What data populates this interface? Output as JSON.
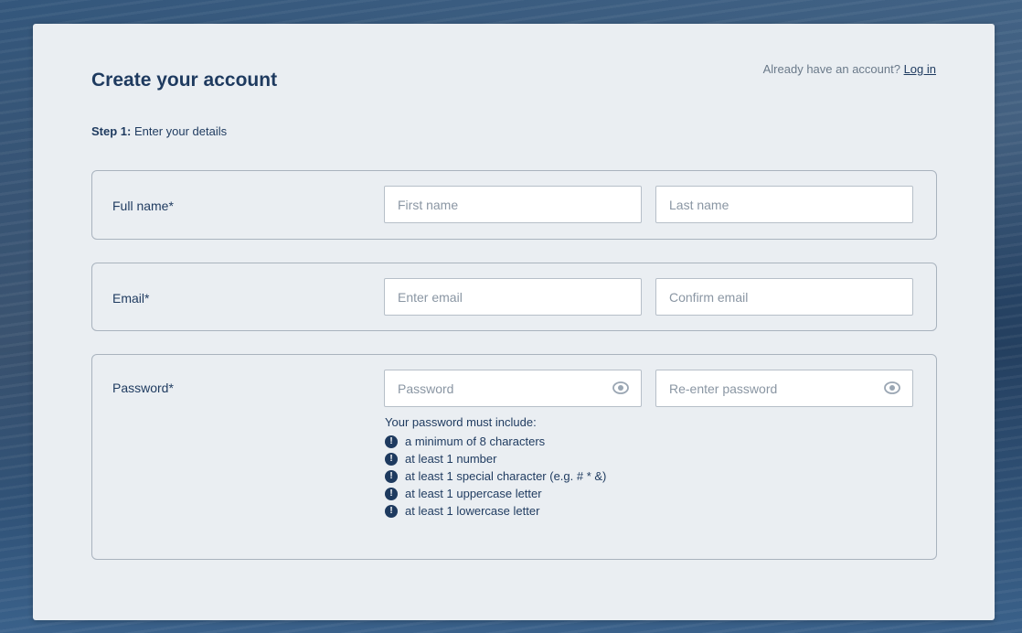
{
  "page": {
    "title": "Create your account",
    "login_prompt": "Already have an account?",
    "login_link": "Log in",
    "step_label": "Step 1:",
    "step_text": " Enter your details"
  },
  "full_name": {
    "label": "Full name*",
    "first_placeholder": "First name",
    "last_placeholder": "Last name"
  },
  "email": {
    "label": "Email*",
    "email_placeholder": "Enter email",
    "confirm_placeholder": "Confirm email"
  },
  "password": {
    "label": "Password*",
    "password_placeholder": "Password",
    "reenter_placeholder": "Re-enter password",
    "rules_heading": "Your password must include:",
    "rules": [
      "a minimum of 8 characters",
      "at least 1 number",
      "at least 1 special character (e.g. # * &)",
      "at least 1 uppercase letter",
      "at least 1 lowercase letter"
    ],
    "rule_icon": "exclamation-circle-icon",
    "show_icon": "eye-icon"
  },
  "colors": {
    "brand_navy": "#1e3a5f",
    "card_bg": "#eaeef2",
    "border": "#a9b3be"
  }
}
